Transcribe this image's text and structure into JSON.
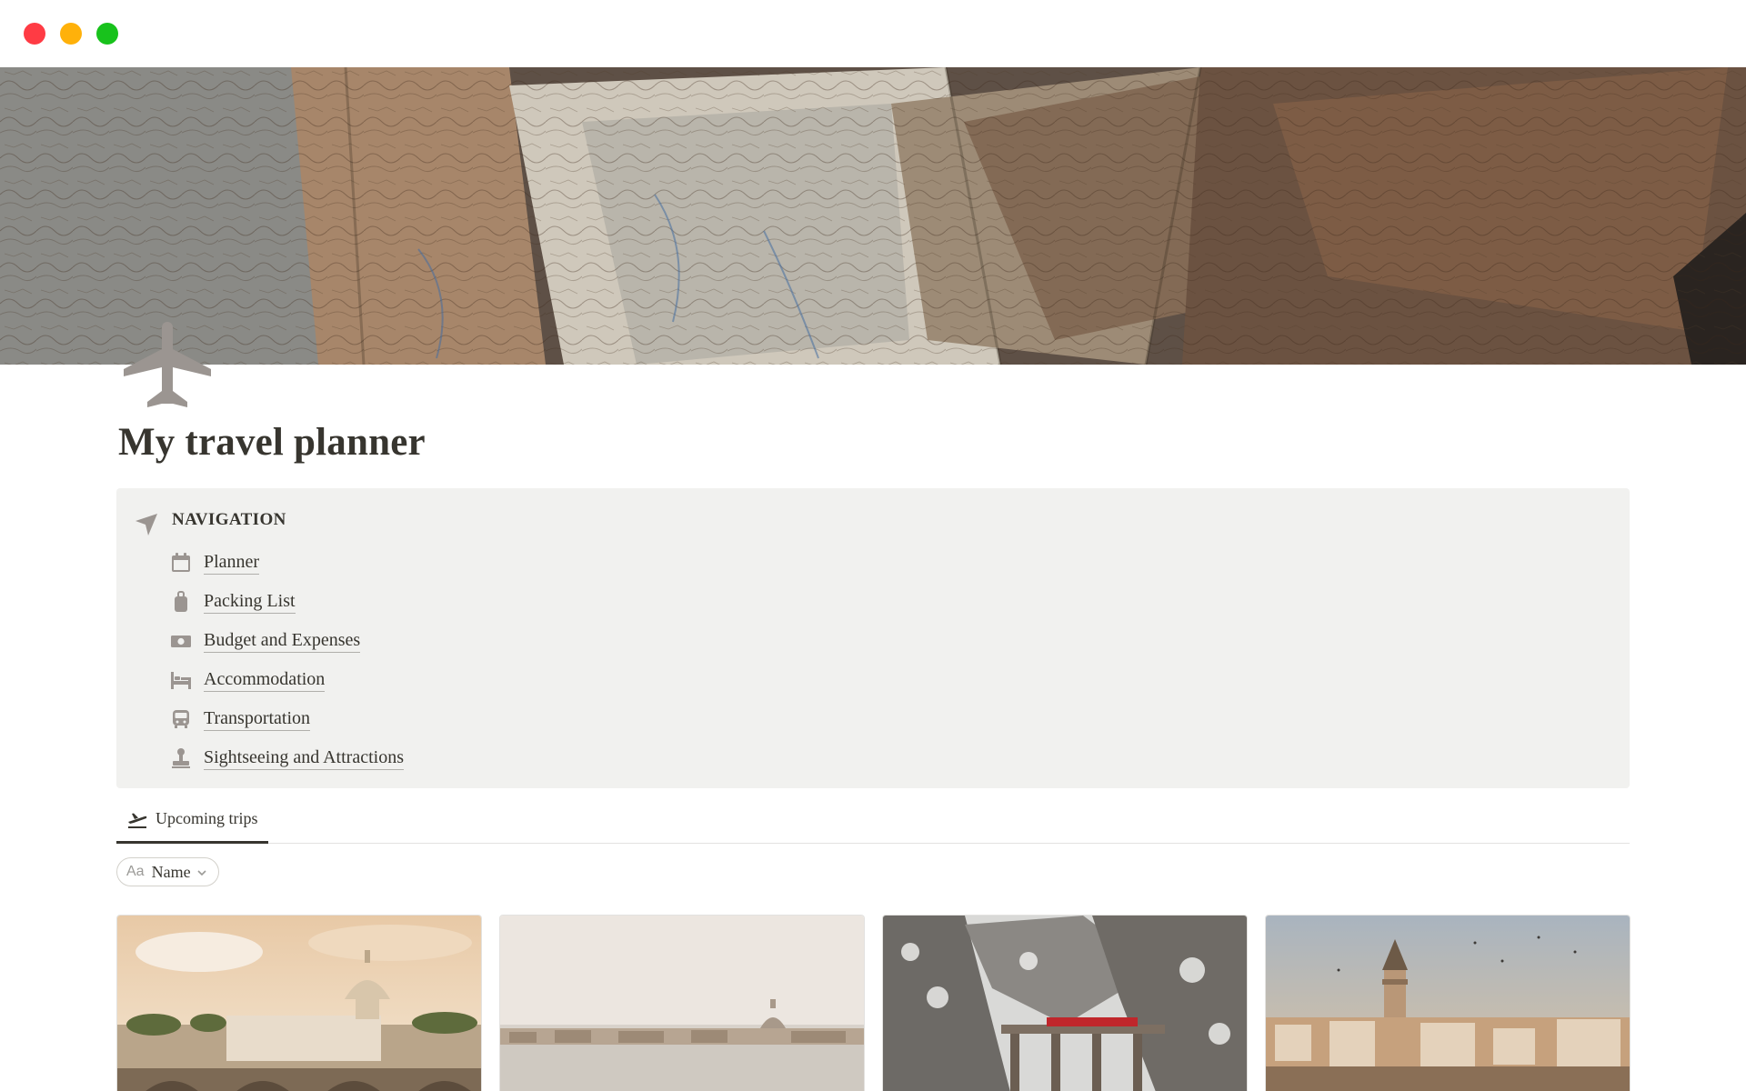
{
  "page": {
    "title": "My travel planner",
    "icon": "airplane-icon"
  },
  "window": {
    "controls": [
      "close",
      "minimize",
      "zoom"
    ]
  },
  "navigation": {
    "icon": "location-arrow-icon",
    "heading": "NAVIGATION",
    "items": [
      {
        "label": "Planner",
        "icon": "calendar-icon"
      },
      {
        "label": "Packing List",
        "icon": "luggage-icon"
      },
      {
        "label": "Budget and Expenses",
        "icon": "money-icon"
      },
      {
        "label": "Accommodation",
        "icon": "bed-icon"
      },
      {
        "label": "Transportation",
        "icon": "bus-icon"
      },
      {
        "label": "Sightseeing and Attractions",
        "icon": "stamp-icon"
      }
    ]
  },
  "view_tabs": [
    {
      "label": "Upcoming trips",
      "icon": "airplane-departure-icon",
      "active": true
    }
  ],
  "filter": {
    "property_icon_text": "Aa",
    "label": "Name"
  },
  "gallery": {
    "cards": [
      {
        "cover": "rome-vatican-photo"
      },
      {
        "cover": "venice-lagoon-photo"
      },
      {
        "cover": "snowy-train-viaduct-photo"
      },
      {
        "cover": "istanbul-galata-tower-photo"
      }
    ]
  },
  "colors": {
    "text": "#37352f",
    "callout_background": "#f1f1ef",
    "icon_gray": "#9b9591",
    "close": "#ff3b44",
    "minimize": "#ffb10a",
    "zoom": "#18c21c"
  }
}
